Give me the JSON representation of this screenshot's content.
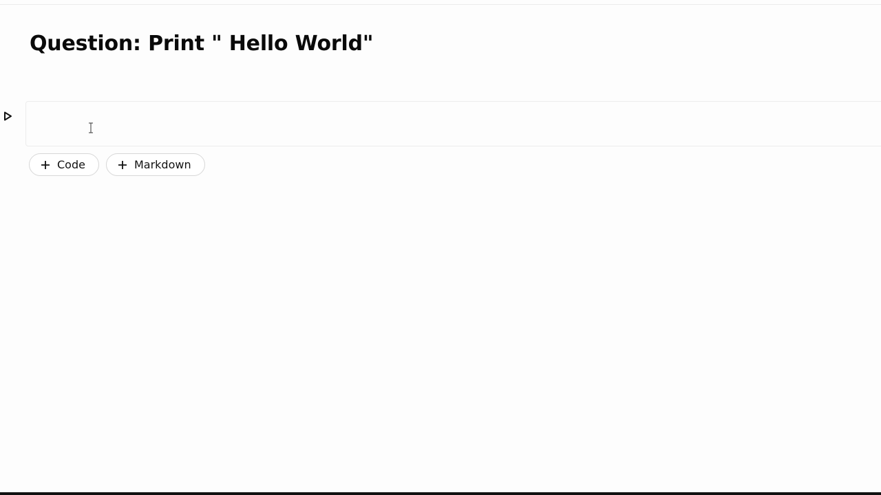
{
  "notebook": {
    "markdown_heading": "Question: Print \" Hello World\"",
    "code_cell": {
      "content": ""
    },
    "add_cell_buttons": {
      "code_label": "Code",
      "markdown_label": "Markdown"
    }
  },
  "icons": {
    "run": "run-triangle-icon",
    "plus": "plus-icon",
    "cursor": "text-cursor-icon"
  }
}
